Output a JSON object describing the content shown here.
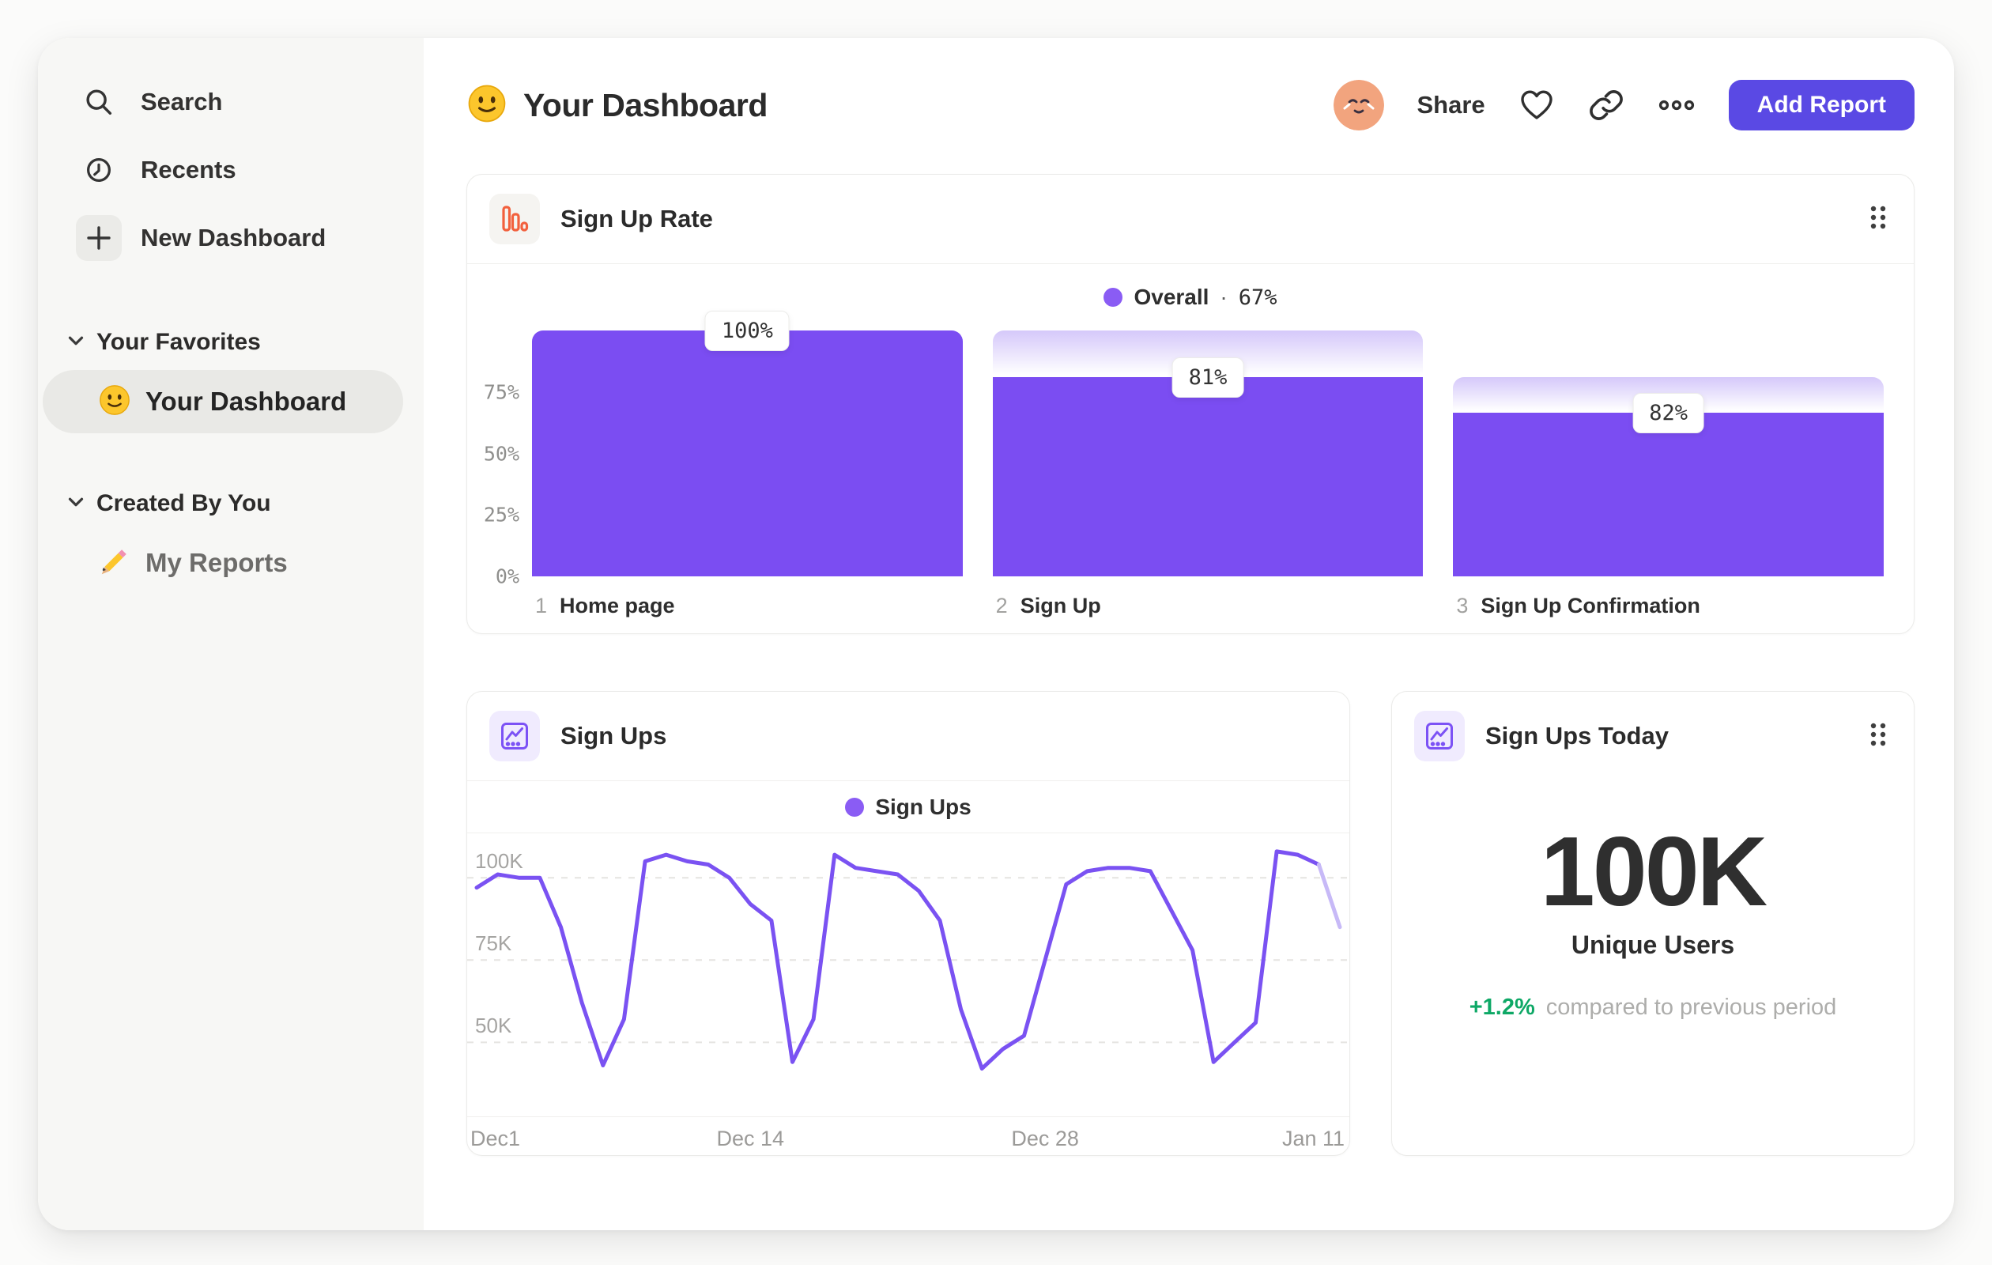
{
  "sidebar": {
    "nav": [
      {
        "label": "Search",
        "icon": "search"
      },
      {
        "label": "Recents",
        "icon": "clock"
      },
      {
        "label": "New Dashboard",
        "icon": "plus"
      }
    ],
    "sections": [
      {
        "label": "Your Favorites",
        "items": [
          {
            "label": "Your Dashboard",
            "emoji": "🙂",
            "selected": true
          }
        ]
      },
      {
        "label": "Created By You",
        "items": [
          {
            "label": "My Reports",
            "emoji": "✏️",
            "selected": false
          }
        ]
      }
    ]
  },
  "header": {
    "title_emoji": "🙂",
    "title": "Your Dashboard",
    "share_label": "Share",
    "add_report_label": "Add Report"
  },
  "colors": {
    "bar_purple": "#7b4df2",
    "legend_purple": "#8a5cf4",
    "button_purple": "#5a49e4",
    "icon_orange": "#f2603d",
    "icon_purple": "#7c52f5",
    "green": "#0ea866"
  },
  "chart_data": [
    {
      "type": "bar",
      "card_title": "Sign Up Rate",
      "legend_label": "Overall",
      "legend_sep": "·",
      "legend_value": "67%",
      "step_numbers": [
        "1",
        "2",
        "3"
      ],
      "categories": [
        "Home page",
        "Sign Up",
        "Sign Up Confirmation"
      ],
      "values": [
        100,
        81,
        82
      ],
      "value_labels": [
        "100%",
        "81%",
        "82%"
      ],
      "cumulative_pct": [
        100,
        81,
        66.4
      ],
      "y_ticks": [
        {
          "label": "0%",
          "value": 0
        },
        {
          "label": "25%",
          "value": 25
        },
        {
          "label": "50%",
          "value": 50
        },
        {
          "label": "75%",
          "value": 75
        }
      ],
      "ylim": [
        0,
        100
      ],
      "bar_color": "#7b4df2",
      "gradient_top_color": "#d5c8fa"
    },
    {
      "type": "line",
      "card_title": "Sign Ups",
      "legend_label": "Sign Ups",
      "unit": "K",
      "x_ticks": [
        {
          "label": "Dec1",
          "day": 0,
          "align": "left"
        },
        {
          "label": "Dec 14",
          "day": 13,
          "align": "center"
        },
        {
          "label": "Dec 28",
          "day": 27,
          "align": "center"
        },
        {
          "label": "Jan 11",
          "day": 41,
          "align": "right"
        }
      ],
      "values_thousands": [
        97,
        101,
        100,
        100,
        85,
        62,
        43,
        57,
        105,
        107,
        105,
        104,
        100,
        92,
        87,
        44,
        57,
        107,
        103,
        102,
        101,
        96,
        87,
        60,
        42,
        48,
        52,
        75,
        98,
        102,
        103,
        103,
        102,
        90,
        78,
        44,
        50,
        56,
        108,
        107,
        104,
        85
      ],
      "y_ticks": [
        {
          "label": "100K",
          "value": 100
        },
        {
          "label": "75K",
          "value": 75
        },
        {
          "label": "50K",
          "value": 50
        }
      ],
      "ylim": [
        27.5,
        113.5
      ],
      "grid": "dashed-horizontal",
      "line_color": "#7a52f2",
      "incomplete_color": "#c7b9f7",
      "incomplete_last_segment": true
    },
    {
      "type": "number",
      "card_title": "Sign Ups Today",
      "value": "100K",
      "label": "Unique Users",
      "delta": "+1.2%",
      "note": "compared to previous period"
    }
  ]
}
